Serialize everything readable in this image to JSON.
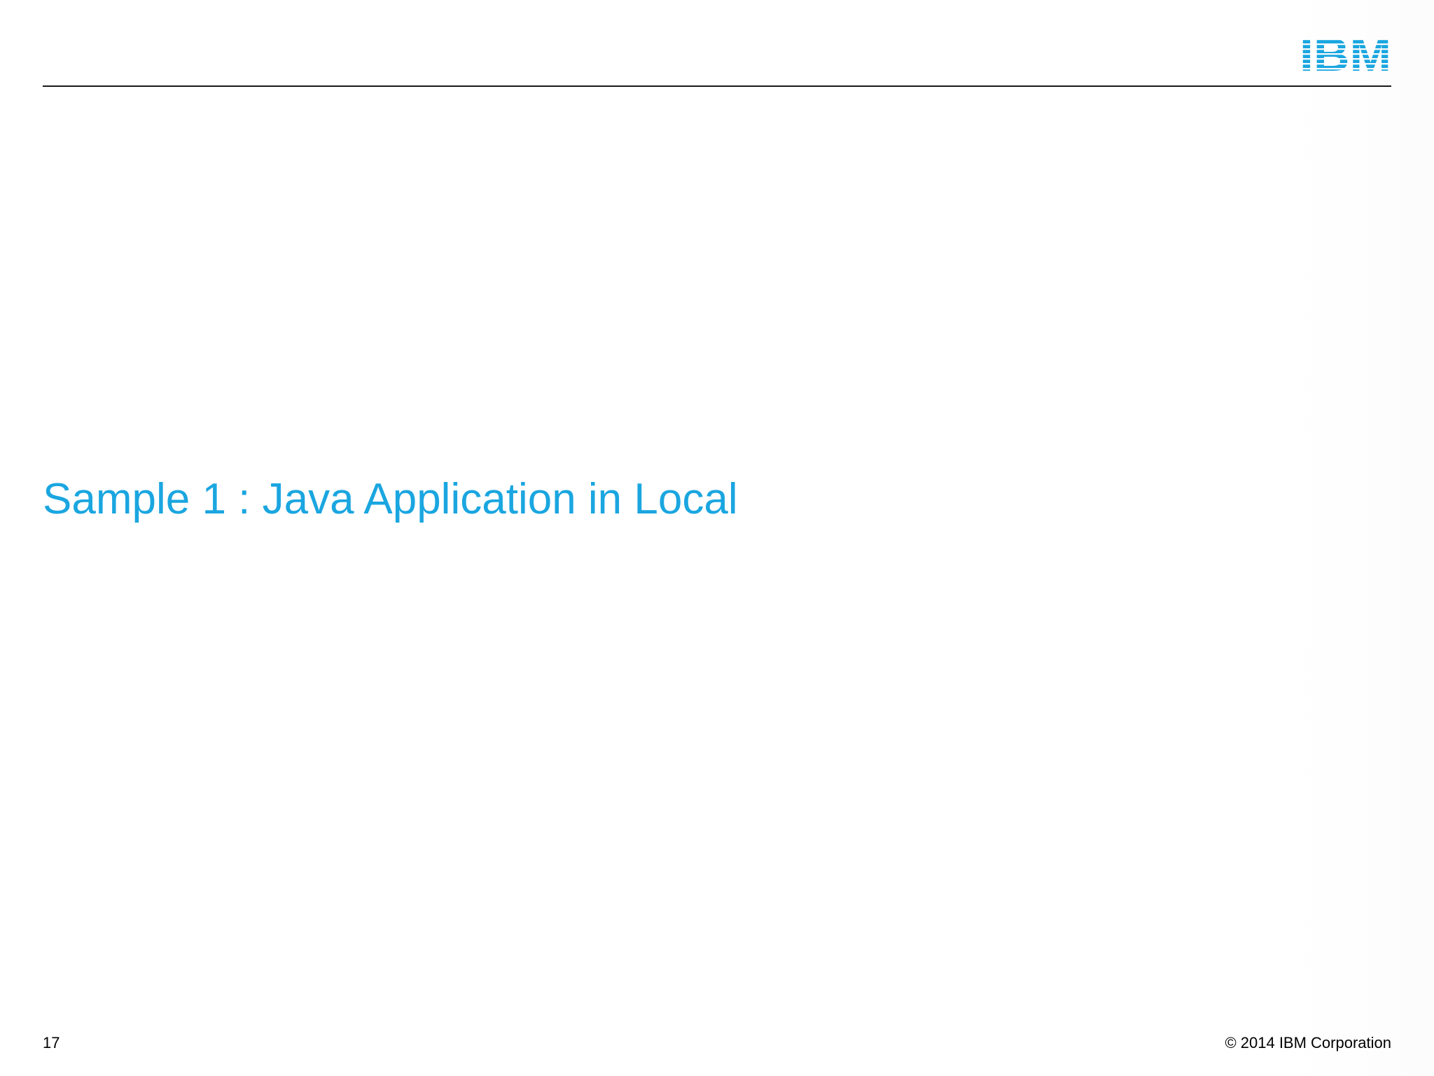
{
  "slide": {
    "logo_text": "IBM",
    "title": "Sample 1 : Java Application in Local",
    "page_number": "17",
    "copyright": "© 2014 IBM Corporation"
  },
  "colors": {
    "accent": "#1aa6e0",
    "text": "#000000",
    "rule": "#1a1a1a",
    "background": "#ffffff"
  },
  "icons": {
    "logo": "ibm-striped-logo-icon"
  }
}
